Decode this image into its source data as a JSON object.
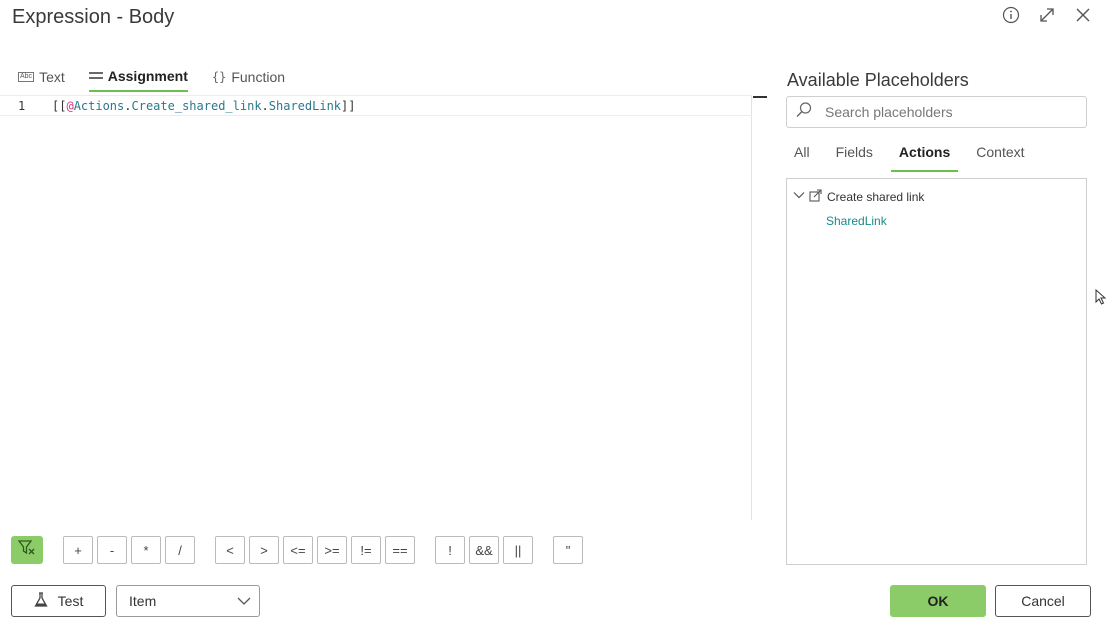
{
  "dialog": {
    "title": "Expression - Body"
  },
  "header_icons": [
    "info-icon",
    "expand-icon",
    "close-icon"
  ],
  "modes": [
    {
      "label": "Text",
      "icon": "text-abc-icon",
      "active": false
    },
    {
      "label": "Assignment",
      "icon": "equals-icon",
      "active": true
    },
    {
      "label": "Function",
      "icon": "braces-icon",
      "active": false
    }
  ],
  "editor": {
    "line_number": "1",
    "code": {
      "open": "[[",
      "at": "@",
      "part1": "Actions",
      "dot1": ".",
      "part2": "Create_shared_link",
      "dot2": ".",
      "part3": "SharedLink",
      "close": "]]"
    }
  },
  "placeholders": {
    "title": "Available Placeholders",
    "search_placeholder": "Search placeholders",
    "tabs": [
      {
        "label": "All",
        "active": false
      },
      {
        "label": "Fields",
        "active": false
      },
      {
        "label": "Actions",
        "active": true
      },
      {
        "label": "Context",
        "active": false
      }
    ],
    "tree": {
      "node_label": "Create shared link",
      "leaf_label": "SharedLink"
    }
  },
  "operators": [
    "+",
    "-",
    "*",
    "/",
    "<",
    ">",
    "<=",
    ">=",
    "!=",
    "==",
    "!",
    "&&",
    "||",
    "\""
  ],
  "footer": {
    "test_label": "Test",
    "select_value": "Item",
    "ok_label": "OK",
    "cancel_label": "Cancel"
  },
  "colors": {
    "accent": "#8ccc68",
    "underline": "#6cc04a",
    "leaf": "#1a8a8a",
    "token": "#2a7a8a",
    "at": "#d33682"
  }
}
